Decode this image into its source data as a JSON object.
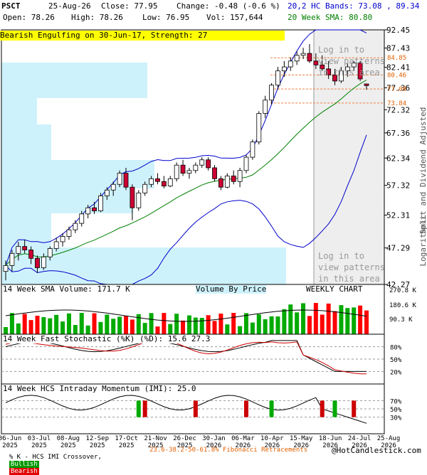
{
  "header": {
    "symbol": "PSCT",
    "date": "25-Aug-26",
    "close_label": "Close: 77.95",
    "change_label": "Change: -0.48 (-0.6 %)",
    "open_label": "Open: 78.26",
    "high_label": "High: 78.26",
    "low_label": "Low: 76.95",
    "vol_label": "Vol: 157,644",
    "hc_bands_label": "20,2 HC Bands: 73.08 , 89.34",
    "sma_label": "20 Week SMA: 80.80",
    "pattern_banner": "Bearish Engulfing on 30-Jun-17, Strength: 27"
  },
  "login_overlay": {
    "top_text": "Log in to\nview patterns\nin this area",
    "bottom_text": "Log in to\nview patterns\nin this area"
  },
  "panels": {
    "volume_title": "14 Week SMA Volume: 171.7 K",
    "volume_by_price": "Volume By Price",
    "weekly_chart": "WEEKLY CHART",
    "stochastic_title": "14 Week Fast Stochastic (%K) (%D): 15.6 27.3",
    "momentum_title": "14 Week HCS Intraday Momentum (IMI): 25.0"
  },
  "footer": {
    "legend_prefix": "% K - HCS IMI Crossover,",
    "bullish": "Bullish",
    "bearish": "Bearish",
    "fib": "23.6-38.2-50-61.8% Fibonacci Retracements",
    "copyright": "@HotCandlestick.com"
  },
  "chart_data": {
    "type": "candlestick",
    "price_axis": {
      "ticks": [
        "92.45",
        "87.43",
        "82.41",
        "77.36",
        "72.32",
        "67.36",
        "62.34",
        "57.32",
        "52.31",
        "47.29",
        "42.27"
      ],
      "label_right": "Split and Dividend Adjusted",
      "scale_label": "Logarithmic",
      "scale": "log",
      "range": [
        42.27,
        92.45
      ]
    },
    "fib_levels": [
      "84.85",
      "80.46",
      "77.08",
      "73.84"
    ],
    "x_ticks": [
      "06-Jun\n2025",
      "03-Jul\n2025",
      "08-Aug\n2025",
      "12-Sep\n2025",
      "17-Oct\n2025",
      "21-Nov\n2025",
      "26-Dec\n2025",
      "30-Jan\n2026",
      "06-Mar\n2026",
      "10-Apr\n2026",
      "15-May\n2026",
      "18-Jun\n2026",
      "24-Jul\n2026",
      "25-Aug\n2026"
    ],
    "candles": [
      {
        "o": 44.0,
        "h": 45.5,
        "l": 42.8,
        "c": 44.8
      },
      {
        "o": 44.8,
        "h": 47.0,
        "l": 44.0,
        "c": 46.5
      },
      {
        "o": 46.5,
        "h": 48.2,
        "l": 45.5,
        "c": 47.5
      },
      {
        "o": 47.5,
        "h": 48.5,
        "l": 46.5,
        "c": 47.0
      },
      {
        "o": 47.0,
        "h": 47.5,
        "l": 45.0,
        "c": 45.8
      },
      {
        "o": 45.8,
        "h": 46.2,
        "l": 43.8,
        "c": 44.5
      },
      {
        "o": 44.5,
        "h": 46.5,
        "l": 44.2,
        "c": 46.0
      },
      {
        "o": 46.0,
        "h": 47.5,
        "l": 45.5,
        "c": 47.2
      },
      {
        "o": 47.2,
        "h": 48.8,
        "l": 46.8,
        "c": 48.2
      },
      {
        "o": 48.2,
        "h": 49.5,
        "l": 47.5,
        "c": 49.0
      },
      {
        "o": 49.0,
        "h": 50.5,
        "l": 48.5,
        "c": 50.0
      },
      {
        "o": 50.0,
        "h": 51.5,
        "l": 49.5,
        "c": 51.0
      },
      {
        "o": 51.0,
        "h": 53.0,
        "l": 50.5,
        "c": 52.5
      },
      {
        "o": 52.5,
        "h": 54.0,
        "l": 51.8,
        "c": 53.5
      },
      {
        "o": 53.5,
        "h": 54.5,
        "l": 52.5,
        "c": 53.0
      },
      {
        "o": 53.0,
        "h": 56.0,
        "l": 52.8,
        "c": 55.5
      },
      {
        "o": 55.5,
        "h": 57.0,
        "l": 54.8,
        "c": 56.5
      },
      {
        "o": 56.5,
        "h": 58.0,
        "l": 55.5,
        "c": 57.5
      },
      {
        "o": 57.5,
        "h": 60.0,
        "l": 57.0,
        "c": 59.5
      },
      {
        "o": 59.5,
        "h": 60.5,
        "l": 56.5,
        "c": 57.0
      },
      {
        "o": 57.0,
        "h": 57.5,
        "l": 51.5,
        "c": 53.5
      },
      {
        "o": 53.5,
        "h": 56.5,
        "l": 53.0,
        "c": 56.0
      },
      {
        "o": 56.0,
        "h": 58.0,
        "l": 55.5,
        "c": 57.5
      },
      {
        "o": 57.5,
        "h": 59.0,
        "l": 57.0,
        "c": 58.5
      },
      {
        "o": 58.5,
        "h": 59.5,
        "l": 57.5,
        "c": 58.0
      },
      {
        "o": 58.0,
        "h": 59.0,
        "l": 56.8,
        "c": 57.2
      },
      {
        "o": 57.2,
        "h": 59.0,
        "l": 57.0,
        "c": 58.5
      },
      {
        "o": 58.5,
        "h": 61.5,
        "l": 58.0,
        "c": 61.0
      },
      {
        "o": 61.0,
        "h": 62.0,
        "l": 59.0,
        "c": 59.5
      },
      {
        "o": 59.5,
        "h": 60.5,
        "l": 58.5,
        "c": 60.0
      },
      {
        "o": 60.0,
        "h": 61.5,
        "l": 59.5,
        "c": 61.0
      },
      {
        "o": 61.0,
        "h": 62.5,
        "l": 60.5,
        "c": 62.0
      },
      {
        "o": 62.0,
        "h": 62.5,
        "l": 60.0,
        "c": 60.5
      },
      {
        "o": 60.5,
        "h": 61.0,
        "l": 58.0,
        "c": 58.5
      },
      {
        "o": 58.5,
        "h": 59.0,
        "l": 56.5,
        "c": 57.0
      },
      {
        "o": 57.0,
        "h": 59.5,
        "l": 56.8,
        "c": 59.0
      },
      {
        "o": 59.0,
        "h": 60.0,
        "l": 57.5,
        "c": 58.0
      },
      {
        "o": 58.0,
        "h": 60.5,
        "l": 57.0,
        "c": 60.0
      },
      {
        "o": 60.0,
        "h": 63.0,
        "l": 59.5,
        "c": 62.5
      },
      {
        "o": 62.5,
        "h": 66.0,
        "l": 62.0,
        "c": 65.5
      },
      {
        "o": 65.5,
        "h": 72.0,
        "l": 65.0,
        "c": 71.5
      },
      {
        "o": 71.5,
        "h": 75.5,
        "l": 70.5,
        "c": 74.5
      },
      {
        "o": 74.5,
        "h": 78.5,
        "l": 73.5,
        "c": 78.0
      },
      {
        "o": 78.0,
        "h": 82.5,
        "l": 77.0,
        "c": 81.5
      },
      {
        "o": 81.5,
        "h": 84.0,
        "l": 80.0,
        "c": 82.5
      },
      {
        "o": 82.5,
        "h": 85.0,
        "l": 81.5,
        "c": 84.0
      },
      {
        "o": 84.0,
        "h": 86.5,
        "l": 83.0,
        "c": 85.5
      },
      {
        "o": 85.5,
        "h": 87.5,
        "l": 84.5,
        "c": 86.0
      },
      {
        "o": 86.0,
        "h": 88.5,
        "l": 83.5,
        "c": 84.0
      },
      {
        "o": 84.0,
        "h": 86.0,
        "l": 82.0,
        "c": 83.0
      },
      {
        "o": 83.0,
        "h": 85.5,
        "l": 81.5,
        "c": 82.0
      },
      {
        "o": 82.0,
        "h": 84.0,
        "l": 79.5,
        "c": 80.5
      },
      {
        "o": 80.5,
        "h": 82.0,
        "l": 78.0,
        "c": 79.0
      },
      {
        "o": 79.0,
        "h": 82.5,
        "l": 78.5,
        "c": 81.5
      },
      {
        "o": 81.5,
        "h": 83.5,
        "l": 80.0,
        "c": 82.5
      },
      {
        "o": 82.5,
        "h": 84.0,
        "l": 81.5,
        "c": 83.5
      },
      {
        "o": 83.5,
        "h": 84.0,
        "l": 79.0,
        "c": 79.5
      },
      {
        "o": 78.3,
        "h": 78.3,
        "l": 76.9,
        "c": 77.9
      }
    ],
    "volume_axis": [
      "270.8 K",
      "180.6 K",
      "90.3 K"
    ],
    "stochastic_axis": [
      "80%",
      "50%",
      "20%"
    ],
    "momentum_axis": [
      "70%",
      "50%",
      "30%"
    ]
  }
}
